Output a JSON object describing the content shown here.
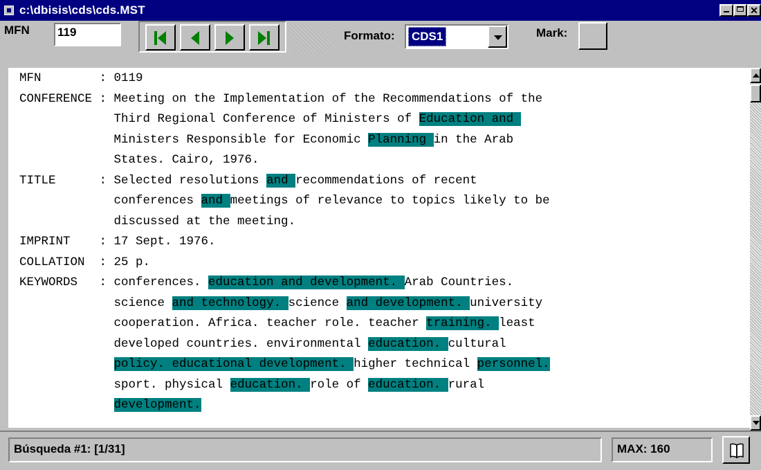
{
  "window": {
    "title": "c:\\dbisis\\cds\\cds.MST"
  },
  "toolbar": {
    "mfn_label": "MFN",
    "mfn_value": "119",
    "format_label": "Formato:",
    "format_value": "CDS1",
    "mark_label": "Mark:"
  },
  "record_lines": [
    [
      {
        "t": "MFN        : 0119"
      }
    ],
    [
      {
        "t": "CONFERENCE : Meeting on the Implementation of the Recommendations of the"
      }
    ],
    [
      {
        "t": "             Third Regional Conference of Ministers of "
      },
      {
        "t": "Education and ",
        "h": true
      }
    ],
    [
      {
        "t": "             Ministers Responsible for Economic "
      },
      {
        "t": "Planning ",
        "h": true
      },
      {
        "t": "in the Arab"
      }
    ],
    [
      {
        "t": "             States. Cairo, 1976."
      }
    ],
    [
      {
        "t": "TITLE      : Selected resolutions "
      },
      {
        "t": "and ",
        "h": true
      },
      {
        "t": "recommendations of recent"
      }
    ],
    [
      {
        "t": "             conferences "
      },
      {
        "t": "and ",
        "h": true
      },
      {
        "t": "meetings of relevance to topics likely to be"
      }
    ],
    [
      {
        "t": "             discussed at the meeting."
      }
    ],
    [
      {
        "t": "IMPRINT    : 17 Sept. 1976."
      }
    ],
    [
      {
        "t": "COLLATION  : 25 p."
      }
    ],
    [
      {
        "t": "KEYWORDS   : conferences. "
      },
      {
        "t": "education and development. ",
        "h": true
      },
      {
        "t": "Arab Countries."
      }
    ],
    [
      {
        "t": "             science "
      },
      {
        "t": "and technology. ",
        "h": true
      },
      {
        "t": "science "
      },
      {
        "t": "and development. ",
        "h": true
      },
      {
        "t": "university"
      }
    ],
    [
      {
        "t": "             cooperation. Africa. teacher role. teacher "
      },
      {
        "t": "training. ",
        "h": true
      },
      {
        "t": "least"
      }
    ],
    [
      {
        "t": "             developed countries. environmental "
      },
      {
        "t": "education. ",
        "h": true
      },
      {
        "t": "cultural"
      }
    ],
    [
      {
        "t": "             "
      },
      {
        "t": "policy. educational development. ",
        "h": true
      },
      {
        "t": "higher technical "
      },
      {
        "t": "personnel.",
        "h": true
      }
    ],
    [
      {
        "t": "             sport. physical "
      },
      {
        "t": "education. ",
        "h": true
      },
      {
        "t": "role of "
      },
      {
        "t": "education. ",
        "h": true
      },
      {
        "t": "rural"
      }
    ],
    [
      {
        "t": "             "
      },
      {
        "t": "development.",
        "h": true
      }
    ]
  ],
  "status": {
    "search_text": "Búsqueda #1: [1/31]",
    "max_text": "MAX: 160"
  },
  "colors": {
    "titlebar": "#000080",
    "highlight": "#008080",
    "face": "#c0c0c0"
  },
  "icons": [
    "app-icon",
    "minimize-icon",
    "maximize-icon",
    "close-icon",
    "first-record-icon",
    "previous-record-icon",
    "next-record-icon",
    "last-record-icon",
    "book-icon"
  ]
}
